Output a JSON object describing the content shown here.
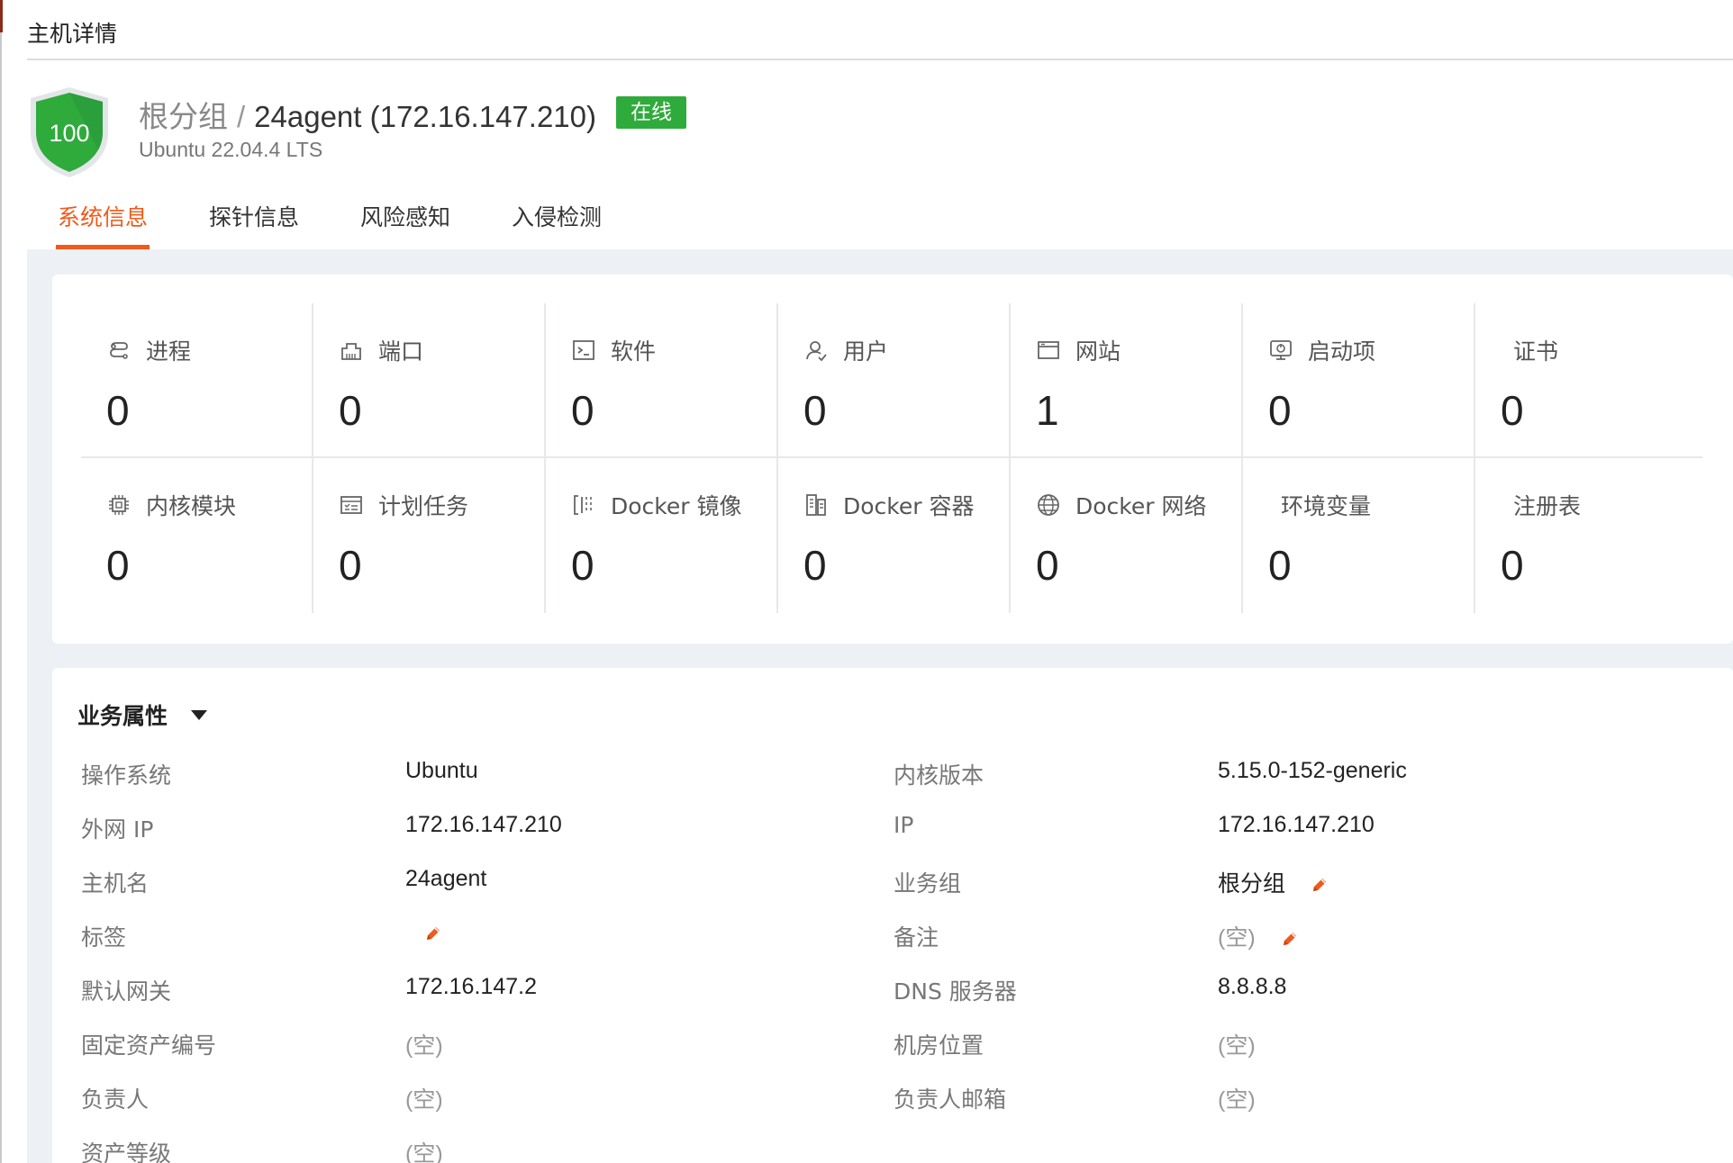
{
  "page": {
    "title": "主机详情"
  },
  "host": {
    "score": "100",
    "group": "根分组",
    "separator": "/",
    "name": "24agent (172.16.147.210)",
    "status": "在线",
    "os": "Ubuntu 22.04.4 LTS"
  },
  "tabs": [
    {
      "label": "系统信息",
      "active": true
    },
    {
      "label": "探针信息",
      "active": false
    },
    {
      "label": "风险感知",
      "active": false
    },
    {
      "label": "入侵检测",
      "active": false
    }
  ],
  "stats": [
    {
      "label": "进程",
      "value": "0",
      "icon": "process-icon"
    },
    {
      "label": "端口",
      "value": "0",
      "icon": "port-icon"
    },
    {
      "label": "软件",
      "value": "0",
      "icon": "terminal-icon"
    },
    {
      "label": "用户",
      "value": "0",
      "icon": "user-icon"
    },
    {
      "label": "网站",
      "value": "1",
      "icon": "website-icon"
    },
    {
      "label": "启动项",
      "value": "0",
      "icon": "startup-icon"
    },
    {
      "label": "证书",
      "value": "0",
      "icon": ""
    },
    {
      "label": "内核模块",
      "value": "0",
      "icon": "chip-icon"
    },
    {
      "label": "计划任务",
      "value": "0",
      "icon": "schedule-icon"
    },
    {
      "label": "Docker 镜像",
      "value": "0",
      "icon": "docker-image-icon"
    },
    {
      "label": "Docker 容器",
      "value": "0",
      "icon": "docker-container-icon"
    },
    {
      "label": "Docker 网络",
      "value": "0",
      "icon": "globe-icon"
    },
    {
      "label": "环境变量",
      "value": "0",
      "icon": ""
    },
    {
      "label": "注册表",
      "value": "0",
      "icon": ""
    }
  ],
  "attributes": {
    "title": "业务属性",
    "left": [
      {
        "key": "操作系统",
        "value": "Ubuntu"
      },
      {
        "key": "外网 IP",
        "value": "172.16.147.210"
      },
      {
        "key": "主机名",
        "value": "24agent"
      },
      {
        "key": "标签",
        "value": ""
      },
      {
        "key": "默认网关",
        "value": "172.16.147.2"
      },
      {
        "key": "固定资产编号",
        "value": "(空)"
      },
      {
        "key": "负责人",
        "value": "(空)"
      },
      {
        "key": "资产等级",
        "value": "(空)"
      }
    ],
    "right": [
      {
        "key": "内核版本",
        "value": "5.15.0-152-generic"
      },
      {
        "key": "IP",
        "value": "172.16.147.210"
      },
      {
        "key": "业务组",
        "value": "根分组"
      },
      {
        "key": "备注",
        "value": "(空)"
      },
      {
        "key": "DNS 服务器",
        "value": "8.8.8.8"
      },
      {
        "key": "机房位置",
        "value": "(空)"
      },
      {
        "key": "负责人邮箱",
        "value": "(空)"
      }
    ]
  },
  "colors": {
    "accent": "#f05a1a",
    "online": "#2fab3c",
    "shield": "#2fab3c"
  }
}
